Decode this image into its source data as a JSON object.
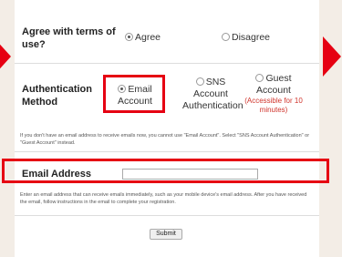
{
  "terms": {
    "label": "Agree with terms of use?",
    "agree": "Agree",
    "disagree": "Disagree"
  },
  "auth": {
    "label": "Authentication Method",
    "email_option": "Email Account",
    "sns_option": "SNS Account Authentication",
    "guest_option": "Guest Account",
    "guest_note": "(Accessible for 10 minutes)"
  },
  "auth_help": "If you don't have an email address to receive emails now, you cannot use \"Email Account\". Select \"SNS Account Authentication\" or \"Guest Account\" instead.",
  "email": {
    "label": "Email Address",
    "value": "",
    "help": "Enter an email address that can receive emails immediately, such as your mobile device's email address. After you have received the email, follow instructions in the email to complete your registration."
  },
  "submit_label": "Submit",
  "colors": {
    "highlight": "#e60012",
    "accent": "#d0342c",
    "background": "#f3ede6"
  }
}
